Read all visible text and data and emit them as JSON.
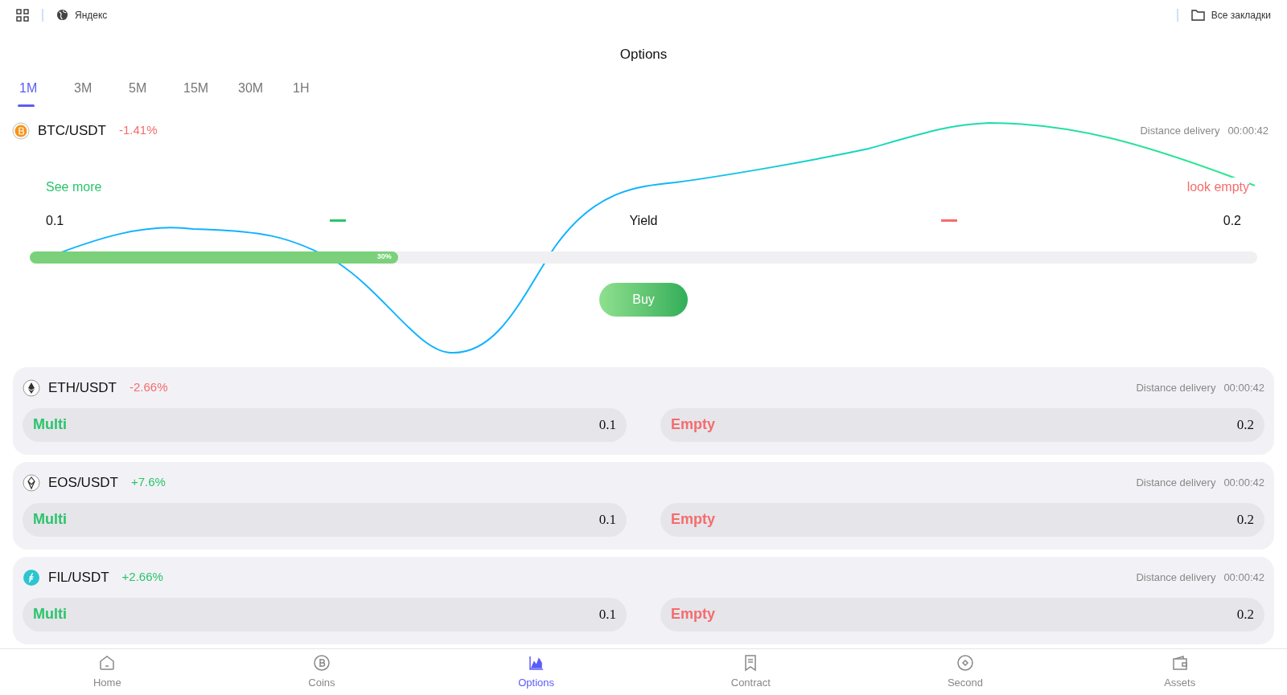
{
  "browser_bar": {
    "bookmark": "Яндекс",
    "all_bookmarks": "Все закладки"
  },
  "title": "Options",
  "tabs": [
    {
      "label": "1M",
      "selected": true
    },
    {
      "label": "3M",
      "selected": false
    },
    {
      "label": "5M",
      "selected": false
    },
    {
      "label": "15M",
      "selected": false
    },
    {
      "label": "30M",
      "selected": false
    },
    {
      "label": "1H",
      "selected": false
    }
  ],
  "featured": {
    "pair": "BTC/USDT",
    "change": "-1.41%",
    "color": "#f56c6c",
    "delivery_label": "Distance delivery",
    "delivery_time": "00:00:42",
    "see_more": "See more",
    "look_empty": "look empty",
    "left_value": "0.1",
    "yield_label": "Yield",
    "right_value": "0.2",
    "progress": {
      "level": 0.3,
      "label": "30%"
    },
    "buy": "Buy"
  },
  "markets": [
    {
      "pair": "ETH/USDT",
      "change": "-2.66%",
      "color": "#f56c6c",
      "delivery_label": "Distance delivery",
      "delivery_time": "00:00:42",
      "multi_label": "Multi",
      "multi_value": "0.1",
      "empty_label": "Empty",
      "empty_value": "0.2"
    },
    {
      "pair": "EOS/USDT",
      "change": "+7.6%",
      "color": "#2bc46b",
      "delivery_label": "Distance delivery",
      "delivery_time": "00:00:42",
      "multi_label": "Multi",
      "multi_value": "0.1",
      "empty_label": "Empty",
      "empty_value": "0.2"
    },
    {
      "pair": "FIL/USDT",
      "change": "+2.66%",
      "color": "#2bc46b",
      "delivery_label": "Distance delivery",
      "delivery_time": "00:00:42",
      "multi_label": "Multi",
      "multi_value": "0.1",
      "empty_label": "Empty",
      "empty_value": "0.2"
    }
  ],
  "nav": [
    {
      "label": "Home",
      "selected": false
    },
    {
      "label": "Coins",
      "selected": false
    },
    {
      "label": "Options",
      "selected": true
    },
    {
      "label": "Contract",
      "selected": false
    },
    {
      "label": "Second",
      "selected": false
    },
    {
      "label": "Assets",
      "selected": false
    }
  ]
}
